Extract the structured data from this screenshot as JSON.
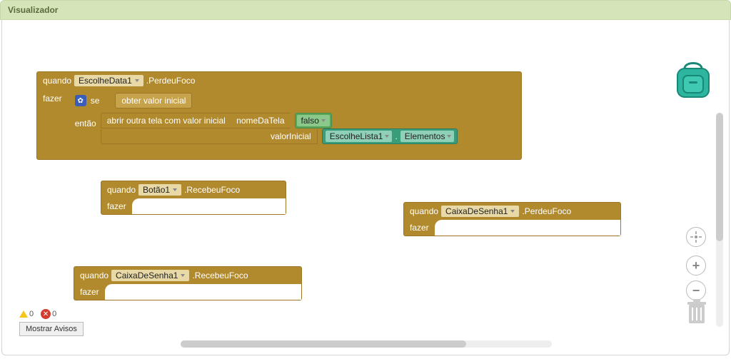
{
  "header": {
    "title": "Visualizador"
  },
  "labels": {
    "when": "quando",
    "do": "fazer",
    "if": "se",
    "then": "então"
  },
  "block1": {
    "component": "EscolheData1",
    "event": ".PerdeuFoco",
    "cond_label": "obter valor inicial",
    "open_screen_label": "abrir outra tela com valor inicial",
    "arg1_label": "nomeDaTela",
    "arg1_value": "falso",
    "arg2_label": "valorInicial",
    "arg2_component": "EscolheLista1",
    "arg2_prop": "Elementos"
  },
  "block2": {
    "component": "Botão1",
    "event": ".RecebeuFoco"
  },
  "block3": {
    "component": "CaixaDeSenha1",
    "event": ".PerdeuFoco"
  },
  "block4": {
    "component": "CaixaDeSenha1",
    "event": ".RecebeuFoco"
  },
  "status": {
    "warnings": "0",
    "errors": "0",
    "show_warnings": "Mostrar Avisos"
  },
  "dot": "."
}
